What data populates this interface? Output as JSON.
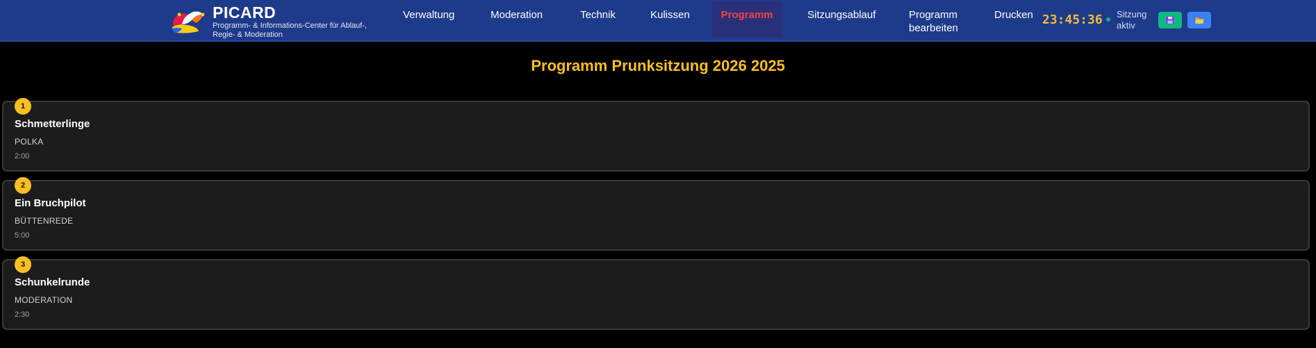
{
  "header": {
    "brand_title": "PICARD",
    "brand_subtitle": "Programm- & Informations-Center für Ablauf-, Regie- & Moderation",
    "nav": [
      {
        "label": "Verwaltung",
        "active": false
      },
      {
        "label": "Moderation",
        "active": false
      },
      {
        "label": "Technik",
        "active": false
      },
      {
        "label": "Kulissen",
        "active": false
      },
      {
        "label": "Programm",
        "active": true
      },
      {
        "label": "Sitzungsablauf",
        "active": false
      },
      {
        "label": "Programm bearbeiten",
        "active": false
      },
      {
        "label": "Drucken",
        "active": false
      }
    ],
    "clock": "23:45:36",
    "status": "Sitzung aktiv",
    "save_icon": "floppy-disk-icon",
    "open_icon": "folder-icon"
  },
  "main": {
    "title": "Programm Prunksitzung 2026 2025",
    "items": [
      {
        "number": "1",
        "title": "Schmetterlinge",
        "type": "POLKA",
        "duration": "2:00"
      },
      {
        "number": "2",
        "title": "Ein Bruchpilot",
        "type": "BÜTTENREDE",
        "duration": "5:00"
      },
      {
        "number": "3",
        "title": "Schunkelrunde",
        "type": "MODERATION",
        "duration": "2:30"
      }
    ]
  },
  "colors": {
    "header_bg": "#1e3a8a",
    "accent_yellow": "#fbbf24",
    "active_nav": "#ef4444",
    "status_green": "#10b981",
    "button_blue": "#3b82f6"
  }
}
